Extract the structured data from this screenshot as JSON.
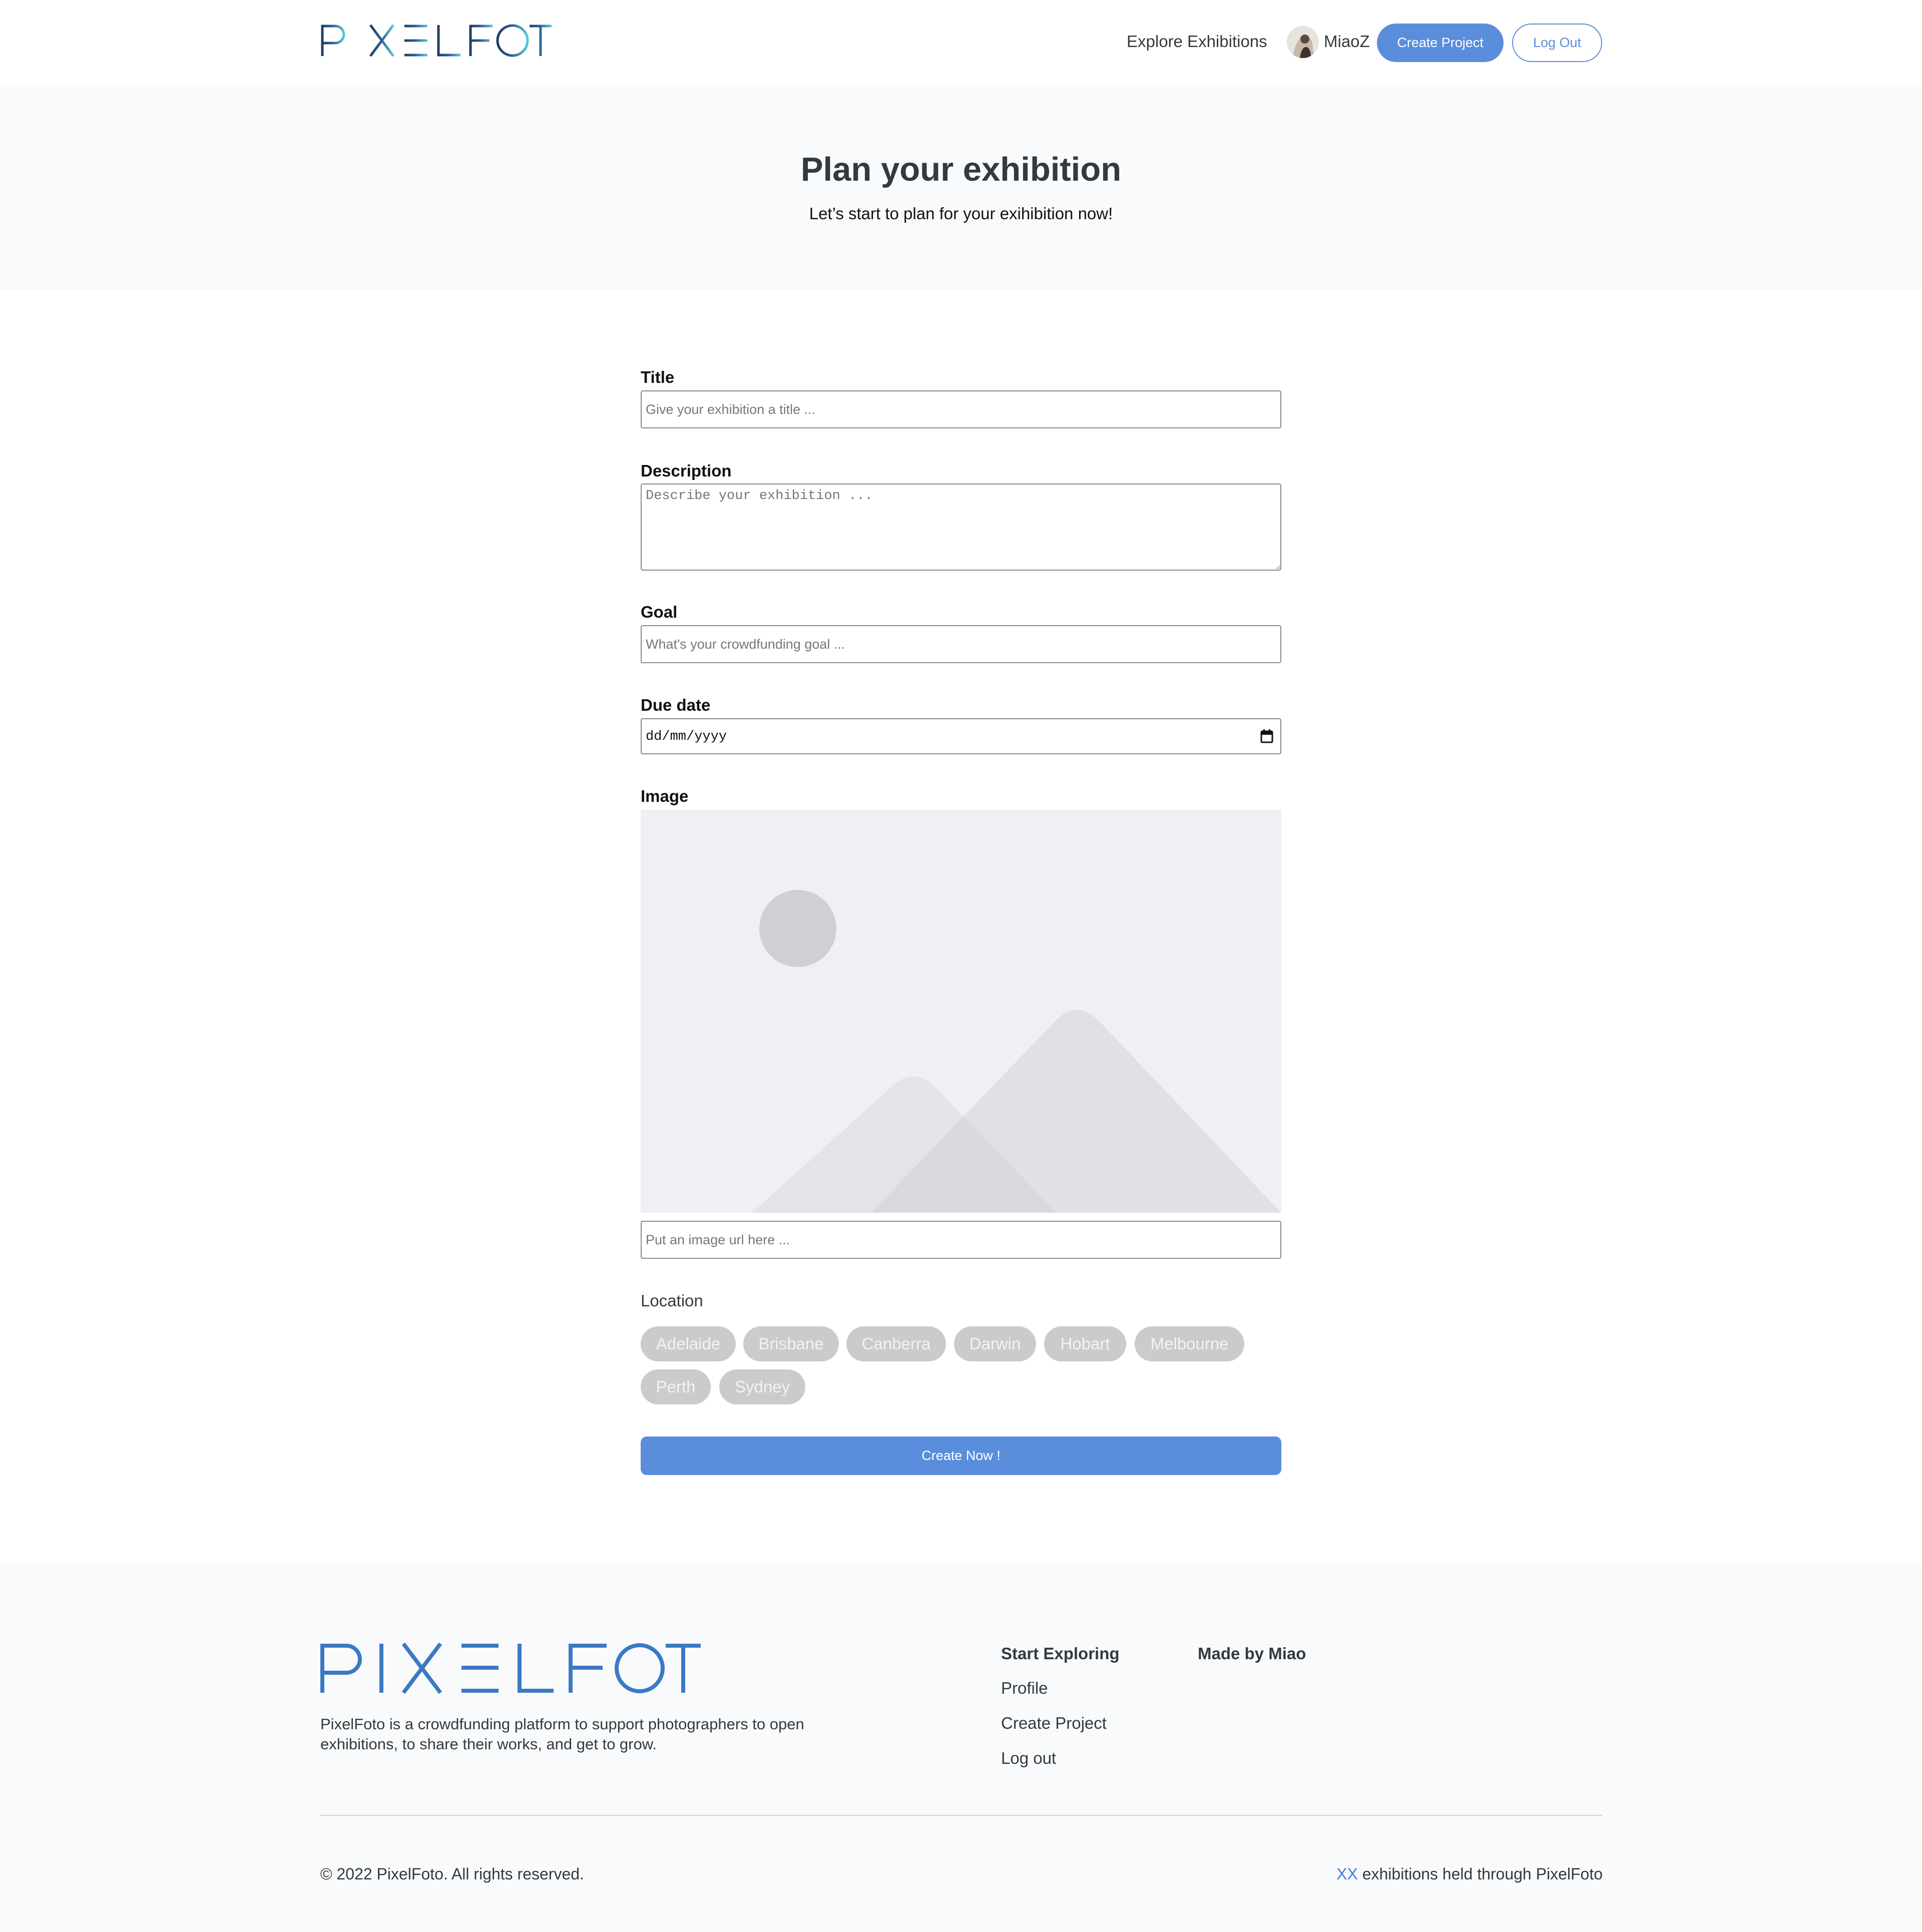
{
  "header": {
    "logo_text": "PIXELFOTO",
    "nav_explore": "Explore Exhibitions",
    "user_name": "MiaoZ",
    "create_project_label": "Create Project",
    "logout_label": "Log Out"
  },
  "hero": {
    "title": "Plan your exhibition",
    "subtitle": "Let’s start to plan for your exihibition now!"
  },
  "form": {
    "title_label": "Title",
    "title_placeholder": "Give your exhibition a title ...",
    "description_label": "Description",
    "description_placeholder": "Describe your exhibition ...",
    "goal_label": "Goal",
    "goal_placeholder": "What's your crowdfunding goal ...",
    "due_date_label": "Due date",
    "due_date_value": "dd/mm/yyyy",
    "image_label": "Image",
    "image_url_placeholder": "Put an image url here ...",
    "location_label": "Location",
    "locations": [
      "Adelaide",
      "Brisbane",
      "Canberra",
      "Darwin",
      "Hobart",
      "Melbourne",
      "Perth",
      "Sydney"
    ],
    "submit_label": "Create Now !"
  },
  "footer": {
    "logo_text": "PIXELFOTO",
    "description": "PixelFoto is a crowdfunding platform to support photographers to open exhibitions, to share their works, and get to grow.",
    "col1_heading": "Start Exploring",
    "col1_links": [
      "Profile",
      "Create Project",
      "Log out"
    ],
    "col2_heading": "Made by Miao",
    "copyright": "© 2022 PixelFoto. All rights reserved.",
    "stats_count": "XX",
    "stats_text": " exhibitions held through PixelFoto"
  },
  "colors": {
    "accent": "#5a8ddb",
    "logo_start": "#1f3d63",
    "logo_end": "#58c8d8",
    "footer_logo": "#3c79c4",
    "chip_bg": "#cacbcd",
    "hero_bg": "#f9fafb"
  },
  "icons": [
    "avatar-photo",
    "calendar-icon",
    "image-placeholder-icon"
  ]
}
